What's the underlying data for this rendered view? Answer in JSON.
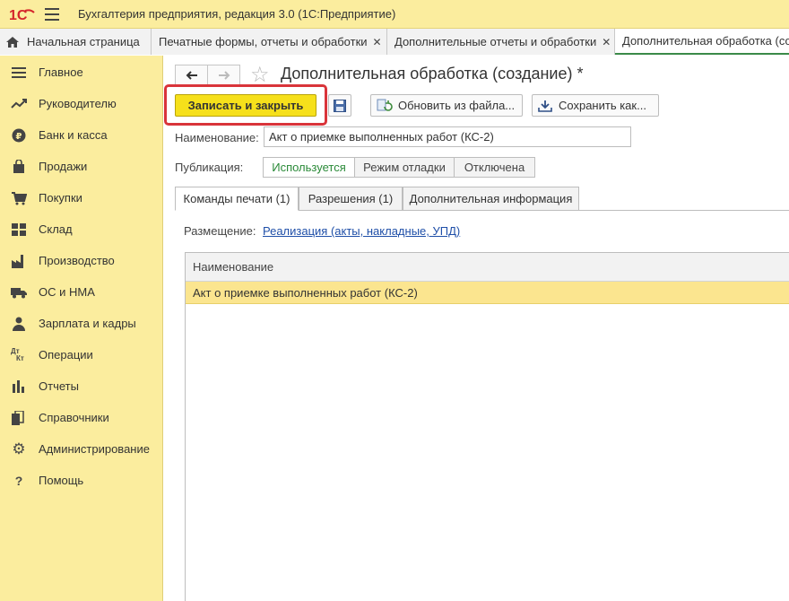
{
  "app": {
    "title": "Бухгалтерия предприятия, редакция 3.0  (1С:Предприятие)",
    "logo_text": "1С"
  },
  "tabs": [
    {
      "label": "Начальная страница"
    },
    {
      "label": "Печатные формы, отчеты и обработки"
    },
    {
      "label": "Дополнительные отчеты и обработки"
    },
    {
      "label": "Дополнительная обработка (со"
    }
  ],
  "sidebar": {
    "items": [
      {
        "label": "Главное",
        "icon": "list-icon"
      },
      {
        "label": "Руководителю",
        "icon": "trend-icon"
      },
      {
        "label": "Банк и касса",
        "icon": "ruble-icon"
      },
      {
        "label": "Продажи",
        "icon": "bag-icon"
      },
      {
        "label": "Покупки",
        "icon": "cart-icon"
      },
      {
        "label": "Склад",
        "icon": "warehouse-icon"
      },
      {
        "label": "Производство",
        "icon": "factory-icon"
      },
      {
        "label": "ОС и НМА",
        "icon": "truck-icon"
      },
      {
        "label": "Зарплата и кадры",
        "icon": "person-icon"
      },
      {
        "label": "Операции",
        "icon": "dt-kt-icon"
      },
      {
        "label": "Отчеты",
        "icon": "bar-chart-icon"
      },
      {
        "label": "Справочники",
        "icon": "books-icon"
      },
      {
        "label": "Администрирование",
        "icon": "gear-icon"
      },
      {
        "label": "Помощь",
        "icon": "question-icon"
      }
    ]
  },
  "form": {
    "title": "Дополнительная обработка (создание) *",
    "toolbar": {
      "save_close": "Записать и закрыть",
      "refresh": "Обновить из файла...",
      "save_as": "Сохранить как..."
    },
    "name_label": "Наименование:",
    "name_value": "Акт о приемке выполненных работ (КС-2)",
    "publication_label": "Публикация:",
    "publication_options": [
      "Используется",
      "Режим отладки",
      "Отключена"
    ],
    "publication_selected": "Используется",
    "inner_tabs": [
      "Команды печати (1)",
      "Разрешения (1)",
      "Дополнительная информация"
    ],
    "placement_label": "Размещение:",
    "placement_link": "Реализация (акты, накладные, УПД)",
    "table": {
      "header": "Наименование",
      "rows": [
        "Акт о приемке выполненных работ (КС-2)"
      ]
    }
  },
  "colors": {
    "accent_yellow": "#fbed9e",
    "button_yellow": "#f6e01b",
    "highlight_red": "#d9343a",
    "active_green": "#2a8a38"
  }
}
